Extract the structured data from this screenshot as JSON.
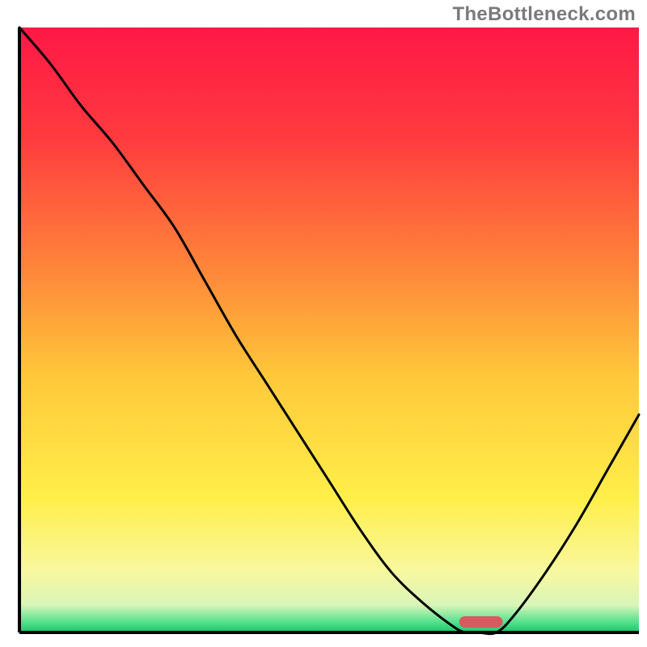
{
  "watermark": "TheBottleneck.com",
  "chart_data": {
    "type": "line",
    "title": "",
    "xlabel": "",
    "ylabel": "",
    "xlim": [
      0,
      100
    ],
    "ylim": [
      0,
      100
    ],
    "x": [
      0,
      5,
      10,
      15,
      20,
      25,
      30,
      35,
      40,
      45,
      50,
      55,
      60,
      65,
      70,
      72,
      74,
      77,
      80,
      85,
      90,
      95,
      100
    ],
    "values": [
      100,
      94,
      87,
      81,
      74,
      67,
      58,
      49,
      41,
      33,
      25,
      17,
      10,
      5,
      1,
      0,
      0,
      0,
      3,
      10,
      18,
      27,
      36
    ],
    "curve_minimum_x_range": [
      71,
      78
    ],
    "marker_at_floor_x_range": [
      71,
      78
    ],
    "gradient_stops": [
      {
        "offset": 0.0,
        "color": "#ff1846"
      },
      {
        "offset": 0.18,
        "color": "#ff3a3f"
      },
      {
        "offset": 0.38,
        "color": "#ff7f3a"
      },
      {
        "offset": 0.58,
        "color": "#ffc93a"
      },
      {
        "offset": 0.78,
        "color": "#ffef4a"
      },
      {
        "offset": 0.9,
        "color": "#f8f8a0"
      },
      {
        "offset": 0.955,
        "color": "#d8f5b8"
      },
      {
        "offset": 0.985,
        "color": "#4adf8a"
      },
      {
        "offset": 1.0,
        "color": "#18c56a"
      }
    ],
    "marker_color": "#d65a5f",
    "axis_color": "#000000"
  }
}
